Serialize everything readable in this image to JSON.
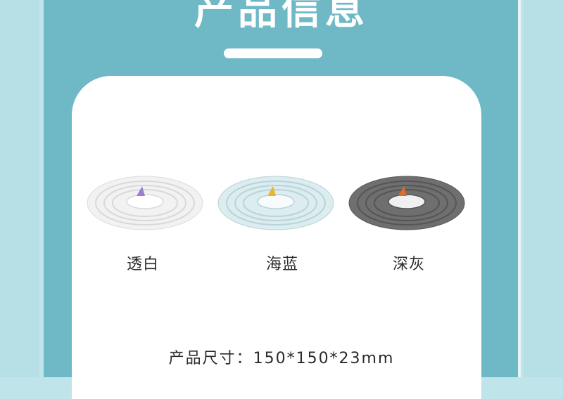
{
  "header": {
    "title": "产品信息"
  },
  "products": [
    {
      "label": "透白",
      "disc_color": "#f2f2f2",
      "ring_color": "#d9d9d9",
      "knob_color": "#ffffff",
      "fin_color": "#9b7fd6"
    },
    {
      "label": "海蓝",
      "disc_color": "#dcecef",
      "ring_color": "#b8d4da",
      "knob_color": "#f7fbfc",
      "fin_color": "#e8b531"
    },
    {
      "label": "深灰",
      "disc_color": "#6f6f6f",
      "ring_color": "#555555",
      "knob_color": "#f0f0f0",
      "fin_color": "#e26a2c"
    }
  ],
  "spec": {
    "text": "产品尺寸：150*150*23mm"
  },
  "colors": {
    "panel": "#6fb9c6",
    "background": "#bfe4ea"
  }
}
